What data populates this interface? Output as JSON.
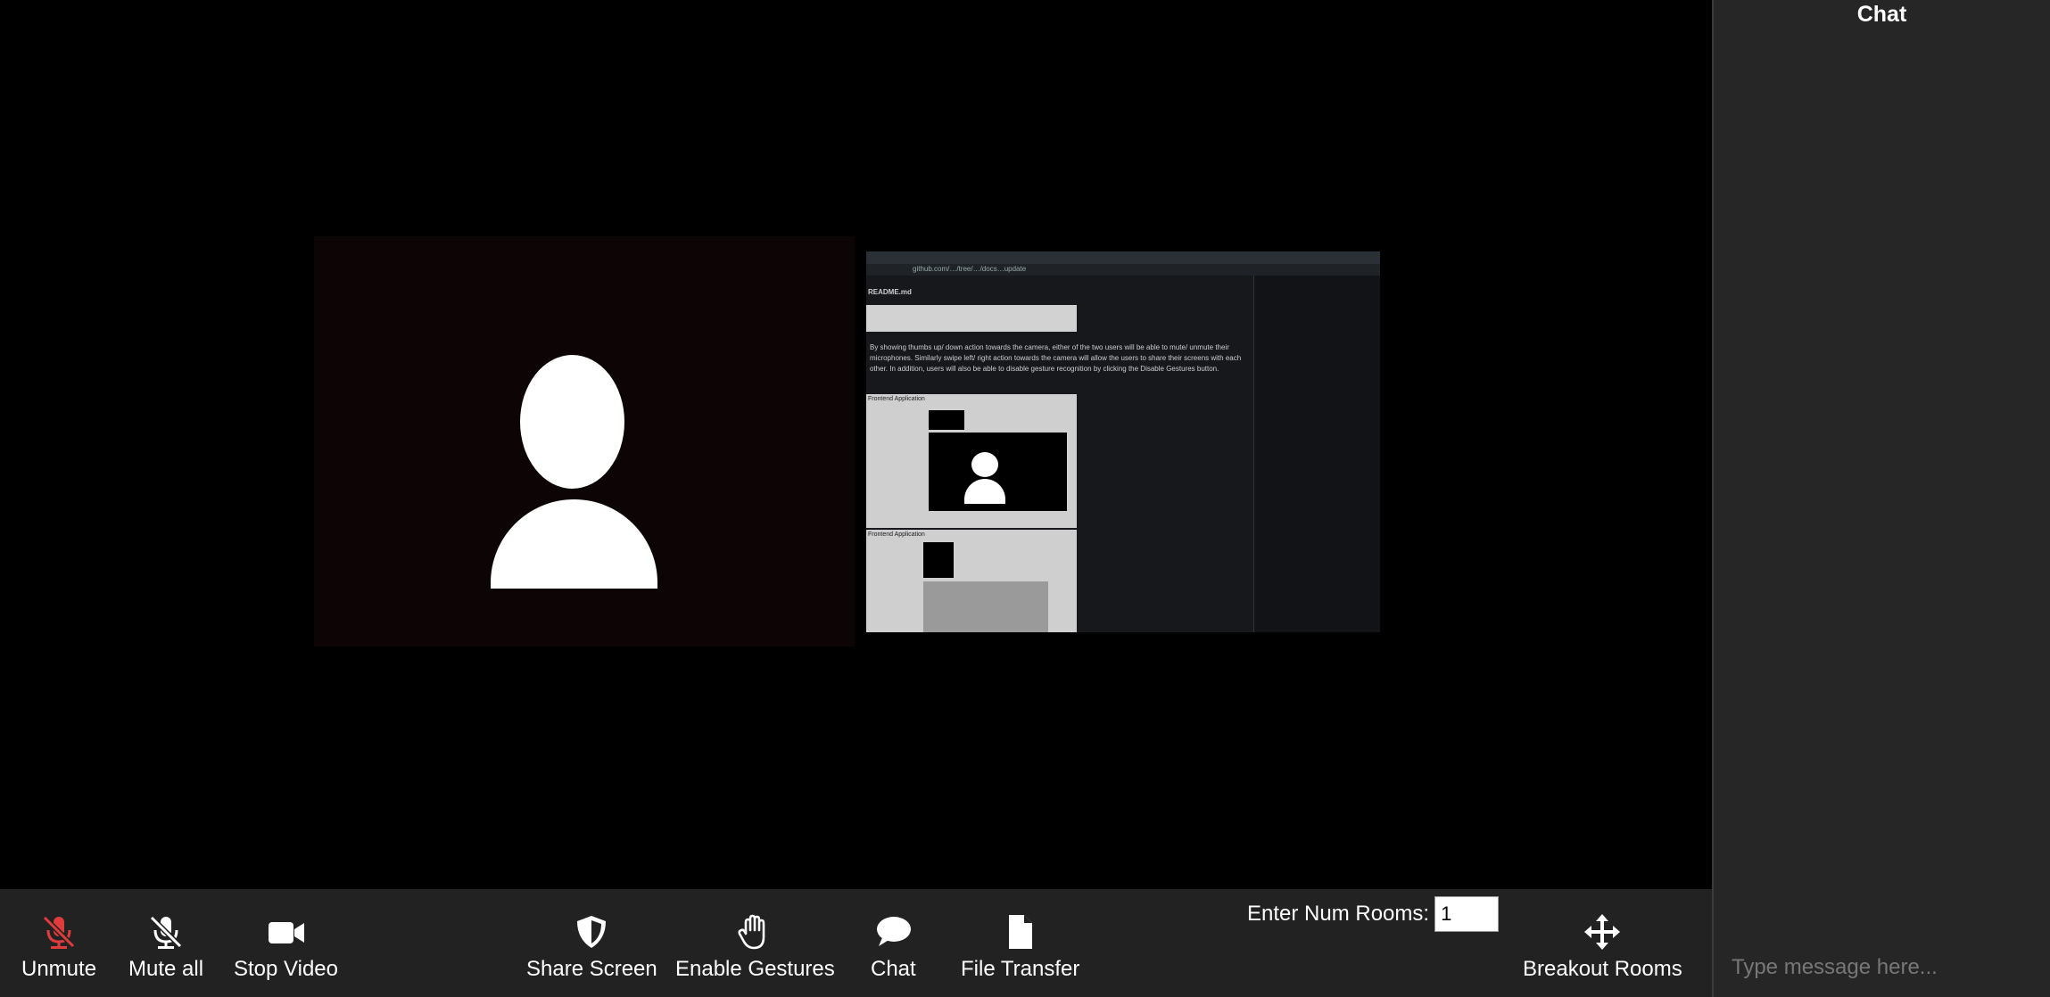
{
  "chat": {
    "title": "Chat",
    "placeholder": "Type message here..."
  },
  "shared_screen": {
    "url": "github.com/…/tree/…/docs…update",
    "file_name": "README.md",
    "paragraph": "By showing thumbs up/ down action towards the camera, either of the two users will be able to mute/ unmute their microphones. Similarly swipe left/ right action towards the camera will allow the users to share their screens with each other. In addition, users will also be able to disable gesture recognition by clicking the Disable Gestures button.",
    "app_label_1": "Frontend Application",
    "app_label_2": "Frontend Application"
  },
  "toolbar": {
    "unmute": "Unmute",
    "mute_all": "Mute all",
    "stop_video": "Stop Video",
    "share_screen": "Share Screen",
    "enable_gestures": "Enable Gestures",
    "chat": "Chat",
    "file_transfer": "File Transfer",
    "rooms_label": "Enter Num Rooms:",
    "rooms_value": "1",
    "breakout_rooms": "Breakout Rooms"
  },
  "colors": {
    "muted_red": "#e03c3c",
    "toolbar_bg": "#222222",
    "chat_bg": "#262626"
  }
}
